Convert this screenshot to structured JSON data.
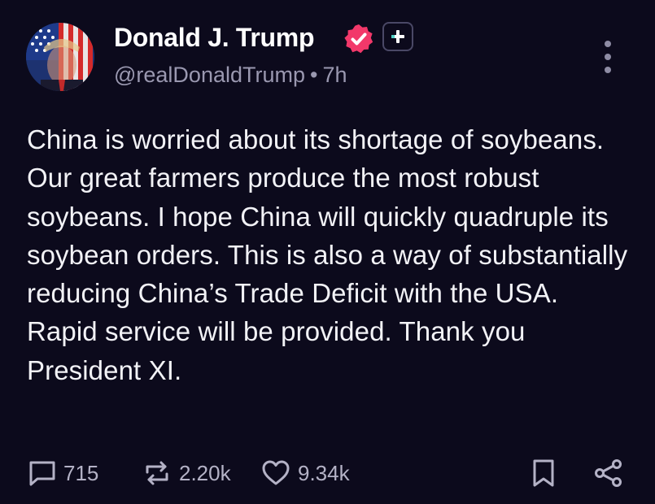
{
  "author": {
    "name": "Donald J. Trump",
    "handle": "@realDonaldTrump",
    "separator": "•",
    "time": "7h"
  },
  "post": {
    "text": "China is worried about its shortage of soybeans. Our great farmers produce the most robust soybeans. I hope China will quickly quadruple its soybean orders. This is also a way of substantially reducing China’s Trade Deficit with the USA. Rapid service will be provided. Thank you President XI."
  },
  "actions": {
    "replies": "715",
    "reposts": "2.20k",
    "likes": "9.34k"
  },
  "icons": {
    "verified": "verified-badge-icon",
    "follow": "plus-icon",
    "more": "more-vertical-icon",
    "reply": "reply-icon",
    "repost": "repost-icon",
    "like": "heart-icon",
    "bookmark": "bookmark-icon",
    "share": "share-icon"
  },
  "colors": {
    "background": "#0c0a1c",
    "verified_badge": "#f2386a",
    "secondary_text": "#9a98b0",
    "action_icons": "#b4b2c6"
  }
}
